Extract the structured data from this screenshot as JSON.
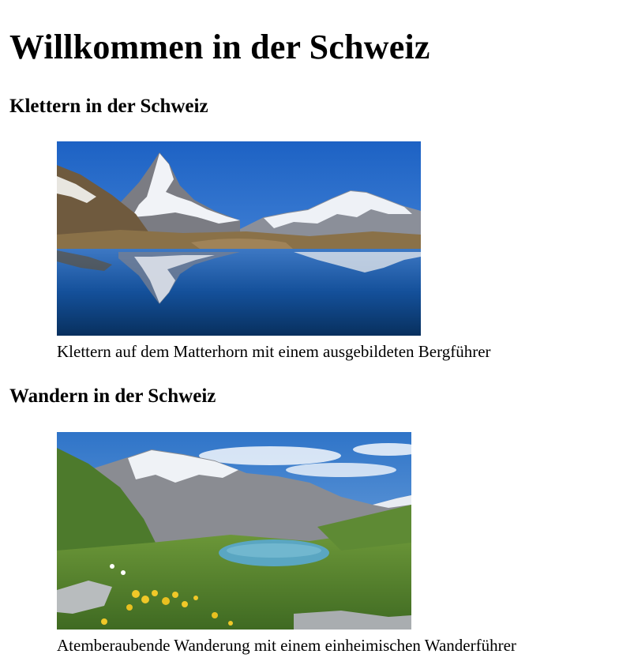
{
  "page": {
    "title": "Willkommen in der Schweiz"
  },
  "sections": [
    {
      "heading": "Klettern in der Schweiz",
      "image": {
        "subject": "matterhorn-lake-photo"
      },
      "caption": "Klettern auf dem Matterhorn mit einem ausgebildeten Bergführer"
    },
    {
      "heading": "Wandern in der Schweiz",
      "image": {
        "subject": "alpine-valley-lake-photo"
      },
      "caption": "Atemberaubende Wanderung mit einem einheimischen Wanderführer"
    }
  ]
}
